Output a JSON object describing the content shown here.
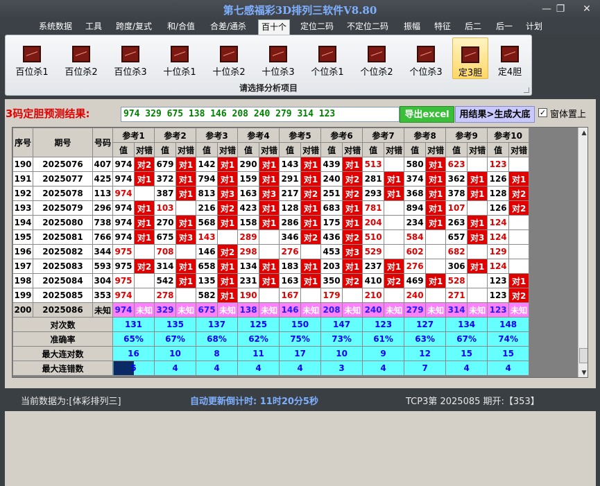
{
  "window": {
    "title": "第七感福彩3D排列三软件V8.80",
    "min": "—",
    "max": "❐",
    "close": "✕"
  },
  "menu": [
    "系统数据",
    "工具",
    "跨度/复式",
    "和/合值",
    "合差/通杀",
    "百十个",
    "定位二码",
    "不定位二码",
    "振幅",
    "特征",
    "后二",
    "后一",
    "计划"
  ],
  "ribbon": {
    "buttons": [
      "百位杀1",
      "百位杀2",
      "百位杀3",
      "十位杀1",
      "十位杀2",
      "十位杀3",
      "个位杀1",
      "个位杀2",
      "个位杀3",
      "定3胆",
      "定4胆"
    ],
    "selected": 9,
    "caption": "请选择分析项目"
  },
  "result": {
    "label": "3码定胆预测结果:",
    "value": "974 329 675 138 146 208 240 279 314 123",
    "export_btn": "导出excel",
    "gen_btn": "用结果>生成大底",
    "pin_checked": "✓",
    "pin_label": "窗体置上"
  },
  "grid": {
    "headers": {
      "seq": "序号",
      "period": "期号",
      "code": "号码",
      "val": "值",
      "hit": "对错"
    },
    "groups": [
      "参考1",
      "参考2",
      "参考3",
      "参考4",
      "参考5",
      "参考6",
      "参考7",
      "参考8",
      "参考9",
      "参考10"
    ],
    "rows": [
      {
        "seq": "190",
        "period": "2025076",
        "code": "407",
        "cells": [
          [
            "974",
            "对2"
          ],
          [
            "679",
            "对1"
          ],
          [
            "142",
            "对1"
          ],
          [
            "290",
            "对1"
          ],
          [
            "143",
            "对1"
          ],
          [
            "439",
            "对1"
          ],
          [
            "513",
            ""
          ],
          [
            "580",
            "对1"
          ],
          [
            "623",
            ""
          ],
          [
            "123",
            ""
          ]
        ]
      },
      {
        "seq": "191",
        "period": "2025077",
        "code": "425",
        "cells": [
          [
            "974",
            "对1"
          ],
          [
            "372",
            "对1"
          ],
          [
            "794",
            "对1"
          ],
          [
            "159",
            "对1"
          ],
          [
            "291",
            "对1"
          ],
          [
            "240",
            "对2"
          ],
          [
            "281",
            "对1"
          ],
          [
            "374",
            "对1"
          ],
          [
            "362",
            "对1"
          ],
          [
            "126",
            "对1"
          ]
        ]
      },
      {
        "seq": "192",
        "period": "2025078",
        "code": "113",
        "cells": [
          [
            "974",
            ""
          ],
          [
            "387",
            "对1"
          ],
          [
            "813",
            "对3"
          ],
          [
            "163",
            "对3"
          ],
          [
            "217",
            "对2"
          ],
          [
            "251",
            "对2"
          ],
          [
            "293",
            "对1"
          ],
          [
            "368",
            "对1"
          ],
          [
            "378",
            "对1"
          ],
          [
            "128",
            "对2"
          ]
        ]
      },
      {
        "seq": "193",
        "period": "2025079",
        "code": "296",
        "cells": [
          [
            "974",
            "对1"
          ],
          [
            "103",
            ""
          ],
          [
            "216",
            "对2"
          ],
          [
            "423",
            "对1"
          ],
          [
            "128",
            "对1"
          ],
          [
            "683",
            "对1"
          ],
          [
            "781",
            ""
          ],
          [
            "894",
            "对1"
          ],
          [
            "107",
            ""
          ],
          [
            "126",
            "对2"
          ]
        ]
      },
      {
        "seq": "194",
        "period": "2025080",
        "code": "738",
        "cells": [
          [
            "974",
            "对1"
          ],
          [
            "270",
            "对1"
          ],
          [
            "568",
            "对1"
          ],
          [
            "158",
            "对1"
          ],
          [
            "286",
            "对1"
          ],
          [
            "175",
            "对1"
          ],
          [
            "204",
            ""
          ],
          [
            "234",
            "对1"
          ],
          [
            "263",
            "对1"
          ],
          [
            "124",
            ""
          ]
        ]
      },
      {
        "seq": "195",
        "period": "2025081",
        "code": "766",
        "cells": [
          [
            "974",
            "对1"
          ],
          [
            "675",
            "对3"
          ],
          [
            "143",
            ""
          ],
          [
            "289",
            ""
          ],
          [
            "346",
            "对2"
          ],
          [
            "436",
            "对2"
          ],
          [
            "510",
            ""
          ],
          [
            "584",
            ""
          ],
          [
            "657",
            "对3"
          ],
          [
            "124",
            ""
          ]
        ]
      },
      {
        "seq": "196",
        "period": "2025082",
        "code": "344",
        "cells": [
          [
            "975",
            ""
          ],
          [
            "708",
            ""
          ],
          [
            "146",
            "对2"
          ],
          [
            "298",
            ""
          ],
          [
            "276",
            ""
          ],
          [
            "453",
            "对3"
          ],
          [
            "529",
            ""
          ],
          [
            "602",
            ""
          ],
          [
            "682",
            ""
          ],
          [
            "129",
            ""
          ]
        ]
      },
      {
        "seq": "197",
        "period": "2025083",
        "code": "593",
        "cells": [
          [
            "975",
            "对2"
          ],
          [
            "314",
            "对1"
          ],
          [
            "658",
            "对1"
          ],
          [
            "134",
            "对1"
          ],
          [
            "183",
            "对1"
          ],
          [
            "203",
            "对1"
          ],
          [
            "237",
            "对1"
          ],
          [
            "276",
            ""
          ],
          [
            "306",
            "对1"
          ],
          [
            "124",
            ""
          ]
        ]
      },
      {
        "seq": "198",
        "period": "2025084",
        "code": "304",
        "cells": [
          [
            "975",
            ""
          ],
          [
            "542",
            "对1"
          ],
          [
            "135",
            "对1"
          ],
          [
            "231",
            "对1"
          ],
          [
            "163",
            "对1"
          ],
          [
            "350",
            "对2"
          ],
          [
            "410",
            "对2"
          ],
          [
            "469",
            "对1"
          ],
          [
            "528",
            ""
          ],
          [
            "123",
            "对1"
          ]
        ]
      },
      {
        "seq": "199",
        "period": "2025085",
        "code": "353",
        "cells": [
          [
            "974",
            ""
          ],
          [
            "278",
            ""
          ],
          [
            "582",
            "对1"
          ],
          [
            "190",
            ""
          ],
          [
            "167",
            ""
          ],
          [
            "179",
            ""
          ],
          [
            "210",
            ""
          ],
          [
            "240",
            ""
          ],
          [
            "271",
            ""
          ],
          [
            "123",
            "对2"
          ]
        ]
      },
      {
        "seq": "200",
        "period": "2025086",
        "code": "未知",
        "cells": [
          [
            "974",
            "未知"
          ],
          [
            "329",
            "未知"
          ],
          [
            "675",
            "未知"
          ],
          [
            "138",
            "未知"
          ],
          [
            "146",
            "未知"
          ],
          [
            "208",
            "未知"
          ],
          [
            "240",
            "未知"
          ],
          [
            "279",
            "未知"
          ],
          [
            "314",
            "未知"
          ],
          [
            "123",
            "未知"
          ]
        ]
      }
    ],
    "stats": [
      {
        "label": "对次数",
        "values": [
          "131",
          "135",
          "137",
          "125",
          "150",
          "147",
          "123",
          "127",
          "134",
          "148"
        ]
      },
      {
        "label": "准确率",
        "values": [
          "65%",
          "67%",
          "68%",
          "62%",
          "75%",
          "73%",
          "61%",
          "63%",
          "67%",
          "74%"
        ]
      },
      {
        "label": "最大连对数",
        "values": [
          "16",
          "10",
          "8",
          "11",
          "17",
          "10",
          "9",
          "12",
          "15",
          "15"
        ]
      },
      {
        "label": "最大连错数",
        "values": [
          "5",
          "4",
          "4",
          "4",
          "4",
          "3",
          "4",
          "7",
          "4",
          "4"
        ]
      }
    ]
  },
  "status": {
    "source": "当前数据为:[体彩排列三]",
    "countdown": "自动更新倒计时:  11时20分5秒",
    "lastdraw": "TCP3第  2025085  期开:【353】"
  }
}
